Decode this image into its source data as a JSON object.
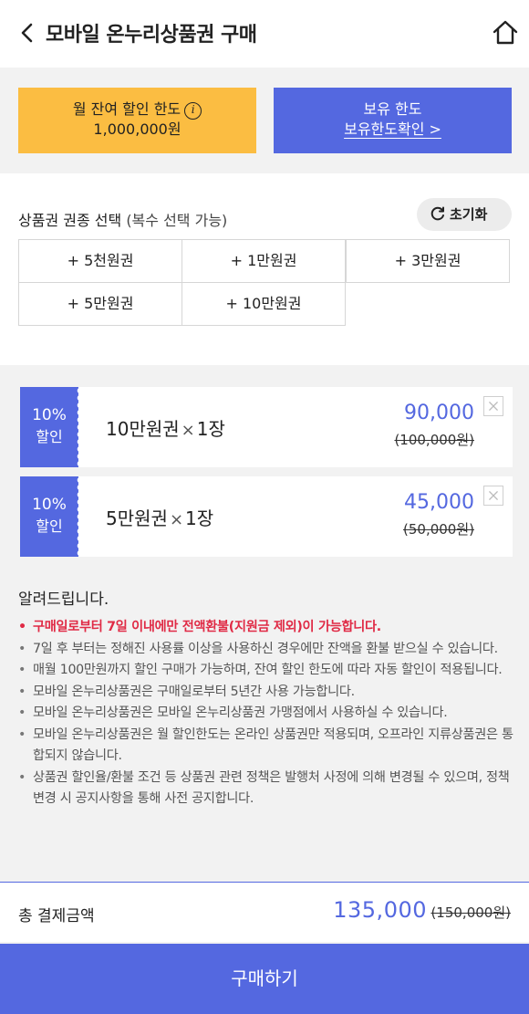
{
  "header": {
    "title": "모바일 온누리상품권 구매",
    "back_icon": "chevron-left-icon",
    "home_icon": "home-icon"
  },
  "limits": {
    "monthly_label": "월 잔여 할인 한도",
    "monthly_value": "1,000,000원",
    "holding_label": "보유 한도",
    "holding_link": "보유한도확인 >"
  },
  "voucher_select": {
    "title": "상품권 권종 선택",
    "subtitle": "(복수 선택 가능)",
    "reset_label": "초기화",
    "options": [
      "+ 5천원권",
      "+ 1만원권",
      "+ 3만원권",
      "+ 5만원권",
      "+ 10만원권"
    ]
  },
  "cart": [
    {
      "discount_pct": "10%",
      "discount_label": "할인",
      "name": "10만원권",
      "times": "×",
      "qty": "1장",
      "price": "90,000",
      "original": "(100,000원)"
    },
    {
      "discount_pct": "10%",
      "discount_label": "할인",
      "name": "5만원권",
      "times": "×",
      "qty": "1장",
      "price": "45,000",
      "original": "(50,000원)"
    }
  ],
  "notice": {
    "title": "알려드립니다.",
    "items": [
      "구매일로부터 7일 이내에만 전액환불(지원금 제외)이 가능합니다.",
      "7일 후 부터는 정해진 사용률 이상을 사용하신 경우에만 잔액을 환불 받으실 수 있습니다.",
      "매월 100만원까지 할인 구매가 가능하며, 잔여 할인 한도에 따라 자동 할인이 적용됩니다.",
      "모바일 온누리상품권은 구매일로부터 5년간 사용 가능합니다.",
      "모바일 온누리상품권은 모바일 온누리상품권 가맹점에서 사용하실 수 있습니다.",
      "모바일 온누리상품권은 월 할인한도는 온라인 상품권만 적용되며, 오프라인 지류상품권은 통합되지 않습니다.",
      "상품권 할인율/환불 조건 등 상품권 관련 정책은 발행처 사정에 의해 변경될 수 있으며, 정책 변경 시 공지사항을 통해 사전 공지합니다."
    ]
  },
  "total": {
    "label": "총 결제금액",
    "amount": "135,000",
    "original": "(150,000원)"
  },
  "buy_button": "구매하기",
  "colors": {
    "accent": "#5468e0",
    "yellow": "#fbbd42",
    "warning_red": "#e02a45"
  }
}
